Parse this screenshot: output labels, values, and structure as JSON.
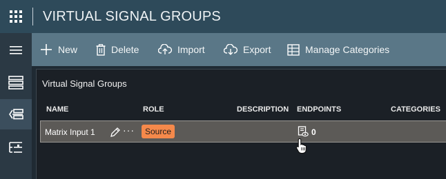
{
  "header": {
    "title": "VIRTUAL SIGNAL GROUPS",
    "apps_icon": "apps-grid-icon"
  },
  "sidebar": {
    "items": [
      {
        "icon": "menu-icon",
        "active": false
      },
      {
        "icon": "list-view-icon",
        "active": false
      },
      {
        "icon": "virtual-signal-groups-icon",
        "active": true
      },
      {
        "icon": "hierarchy-list-icon",
        "active": false
      }
    ]
  },
  "toolbar": {
    "new_label": "New",
    "delete_label": "Delete",
    "import_label": "Import",
    "export_label": "Export",
    "manage_categories_label": "Manage Categories"
  },
  "panel": {
    "title": "Virtual Signal Groups",
    "columns": {
      "name": "NAME",
      "role": "ROLE",
      "description": "DESCRIPTION",
      "endpoints": "ENDPOINTS",
      "categories": "CATEGORIES"
    },
    "rows": [
      {
        "name": "Matrix Input 1",
        "more": "···",
        "role": "Source",
        "description": "",
        "endpoints": "0",
        "categories": ""
      }
    ]
  },
  "colors": {
    "topbar": "#2e4a5a",
    "toolbar": "#5a7787",
    "sidebar": "#2b3944",
    "panel": "#1b2026",
    "row_selected": "#5c5a57",
    "role_source": "#f5894b"
  }
}
